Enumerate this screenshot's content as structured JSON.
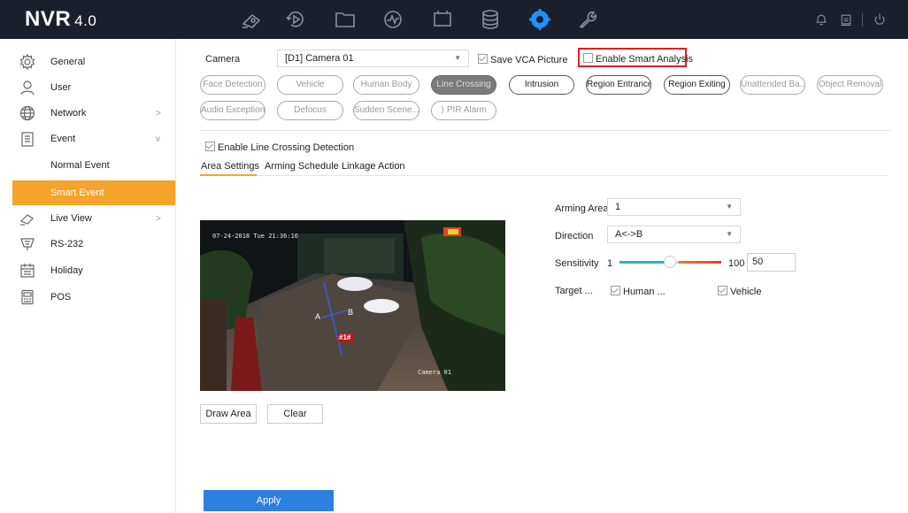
{
  "app": {
    "brand": "NVR",
    "version": "4.0"
  },
  "topnav": {
    "icons": [
      "live-view-icon",
      "playback-icon",
      "file-management-icon",
      "smart-analysis-icon",
      "configuration-window-icon",
      "storage-icon",
      "system-gear-icon",
      "maintenance-icon"
    ],
    "active": "system-gear-icon",
    "right_icons": [
      "alarm-bell-icon",
      "notification-icon",
      "power-icon"
    ]
  },
  "sidebar": {
    "items": [
      {
        "label": "General",
        "icon": "gear-icon"
      },
      {
        "label": "User",
        "icon": "user-icon"
      },
      {
        "label": "Network",
        "icon": "globe-icon",
        "chevron": ">"
      },
      {
        "label": "Event",
        "icon": "clipboard-icon",
        "chevron": "v"
      },
      {
        "label": "Normal Event"
      },
      {
        "label": "Smart Event",
        "active": true
      },
      {
        "label": "Live View",
        "icon": "camera-icon",
        "chevron": ">"
      },
      {
        "label": "RS-232",
        "icon": "rs232-icon"
      },
      {
        "label": "Holiday",
        "icon": "calendar-icon"
      },
      {
        "label": "POS",
        "icon": "pos-icon"
      }
    ]
  },
  "camera": {
    "label": "Camera",
    "value": "[D1] Camera 01",
    "save_vca_label": "Save VCA Picture",
    "save_vca_checked": true,
    "enable_smart_label": "Enable Smart Analysis",
    "enable_smart_checked": false,
    "highlight_color": "#e01e1e"
  },
  "functions": {
    "row1": [
      "Face Detection",
      "Vehicle",
      "Human Body",
      "Line Crossing",
      "Intrusion",
      "Region Entrance",
      "Region Exiting",
      "Unattended Ba...",
      "Object Removal"
    ],
    "row2": [
      "Audio Exception",
      "Defocus",
      "Sudden Scene...",
      "PIR Alarm"
    ],
    "selected": "Line Crossing"
  },
  "enable_detection": {
    "label": "Enable Line Crossing Detection",
    "checked": true
  },
  "tabs": [
    "Area Settings",
    "Arming Schedule",
    "Linkage Action"
  ],
  "active_tab": "Area Settings",
  "video": {
    "timestamp": "07-24-2018 Tue 21:36:16",
    "camera_name": "Camera 01",
    "line_label": "#1#",
    "point_a": "A",
    "point_b": "B"
  },
  "buttons": {
    "draw_area": "Draw Area",
    "clear": "Clear",
    "apply": "Apply"
  },
  "settings": {
    "arming_area_label": "Arming Area",
    "arming_area_value": "1",
    "direction_label": "Direction",
    "direction_value": "A<->B",
    "sensitivity_label": "Sensitivity",
    "sensitivity_min": "1",
    "sensitivity_max": "100",
    "sensitivity_value": "50",
    "target_label": "Target ...",
    "target_human_label": "Human ...",
    "target_human_checked": true,
    "target_vehicle_label": "Vehicle",
    "target_vehicle_checked": true
  },
  "colors": {
    "accent_orange": "#f5a32a",
    "apply_blue": "#2d7fe0",
    "topbar": "#1a1f2b",
    "active_nav": "#1e90ff"
  }
}
